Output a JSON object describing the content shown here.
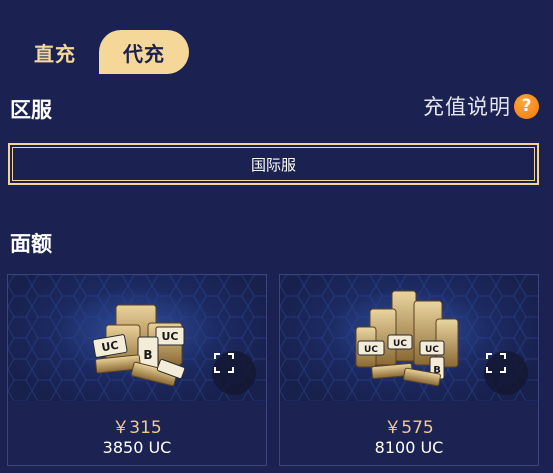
{
  "tabs": [
    {
      "label": "直充",
      "active": false
    },
    {
      "label": "代充",
      "active": true
    }
  ],
  "server": {
    "title": "区服",
    "value": "国际服"
  },
  "help": {
    "label": "充值说明",
    "icon_glyph": "?",
    "icon": "question-icon"
  },
  "denominations": {
    "title": "面额",
    "items": [
      {
        "price": "￥315",
        "amount": "3850 UC",
        "image": "uc-coin-stack-small"
      },
      {
        "price": "￥575",
        "amount": "8100 UC",
        "image": "uc-coin-stack-large"
      }
    ]
  },
  "colors": {
    "background": "#1b2150",
    "accent_gold": "#f6d79a",
    "price": "#f3c98d",
    "help_icon": "#f07a0f"
  }
}
